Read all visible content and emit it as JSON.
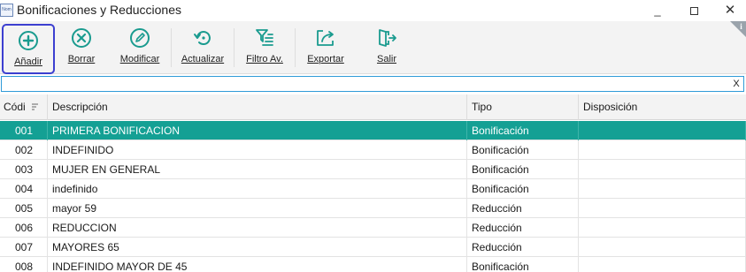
{
  "window": {
    "app_icon_text": "Nom",
    "title": "Bonificaciones y Reducciones",
    "minimize_label": "_",
    "close_label": "✕"
  },
  "toolbar": {
    "anadir": "Añadir",
    "borrar": "Borrar",
    "modificar": "Modificar",
    "actualizar": "Actualizar",
    "filtro": "Filtro Av.",
    "exportar": "Exportar",
    "salir": "Salir",
    "accent_color": "#3c3fd0",
    "icon_color": "#1a9b8f"
  },
  "filter": {
    "value": "",
    "clear_label": "X"
  },
  "grid": {
    "columns": [
      "Códi",
      "Descripción",
      "Tipo",
      "Disposición"
    ],
    "selected_row_color": "#14a094",
    "rows": [
      {
        "code": "001",
        "desc": "PRIMERA BONIFICACION",
        "tipo": "Bonificación",
        "disp": "",
        "selected": true
      },
      {
        "code": "002",
        "desc": "INDEFINIDO",
        "tipo": "Bonificación",
        "disp": ""
      },
      {
        "code": "003",
        "desc": "MUJER EN GENERAL",
        "tipo": "Bonificación",
        "disp": ""
      },
      {
        "code": "004",
        "desc": "indefinido",
        "tipo": "Bonificación",
        "disp": ""
      },
      {
        "code": "005",
        "desc": "mayor 59",
        "tipo": "Reducción",
        "disp": ""
      },
      {
        "code": "006",
        "desc": "REDUCCION",
        "tipo": "Reducción",
        "disp": ""
      },
      {
        "code": "007",
        "desc": "MAYORES 65",
        "tipo": "Reducción",
        "disp": ""
      },
      {
        "code": "008",
        "desc": "INDEFINIDO MAYOR DE 45",
        "tipo": "Bonificación",
        "disp": ""
      }
    ]
  }
}
